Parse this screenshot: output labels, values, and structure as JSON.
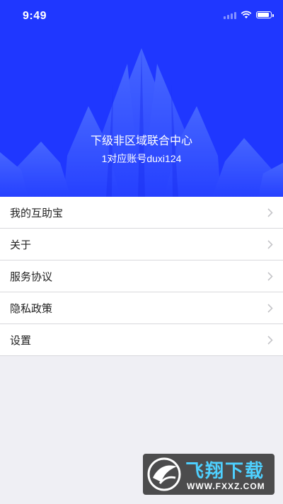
{
  "status_bar": {
    "time": "9:49"
  },
  "profile": {
    "title": "下级非区域联合中心",
    "subtitle": "1对应账号duxi124"
  },
  "menu": {
    "items": [
      {
        "label": "我的互助宝"
      },
      {
        "label": "关于"
      },
      {
        "label": "服务协议"
      },
      {
        "label": "隐私政策"
      },
      {
        "label": "设置"
      }
    ]
  },
  "watermark": {
    "title": "飞翔下载",
    "url": "WWW.FXXZ.COM"
  },
  "colors": {
    "header_blue": "#1f37ff",
    "background": "#efeff4",
    "watermark_accent": "#4ed0ff"
  },
  "icons": [
    "wifi-icon",
    "battery-icon",
    "chevron-right-icon",
    "watermark-logo-icon"
  ]
}
